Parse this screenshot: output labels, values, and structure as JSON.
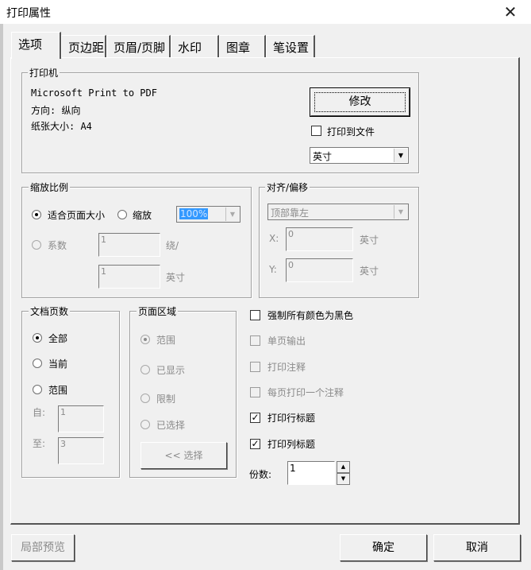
{
  "window": {
    "title": "打印属性",
    "close_symbol": "✕"
  },
  "tabs": [
    "选项",
    "页边距",
    "页眉/页脚",
    "水印",
    "图章",
    "笔设置"
  ],
  "printer_group": {
    "legend": "打印机",
    "printer_name": "Microsoft Print to PDF",
    "orientation": "方向: 纵向",
    "paper_size": "纸张大小: A4",
    "modify_button": "修改",
    "print_to_file": {
      "label": "打印到文件",
      "checked": false
    },
    "unit_select": "英寸"
  },
  "scale_group": {
    "legend": "缩放比例",
    "fit_page": {
      "label": "适合页面大小",
      "selected": true
    },
    "zoom": {
      "label": "缩放",
      "selected": false,
      "value": "100%"
    },
    "factor": {
      "label": "系数",
      "selected": false,
      "value1": "1",
      "unit1": "绕/",
      "value2": "1",
      "unit2": "英寸"
    }
  },
  "align_group": {
    "legend": "对齐/偏移",
    "align_select": "顶部靠左",
    "x": {
      "label": "X:",
      "value": "0",
      "unit": "英寸"
    },
    "y": {
      "label": "Y:",
      "value": "0",
      "unit": "英寸"
    }
  },
  "doc_pages_group": {
    "legend": "文档页数",
    "all": {
      "label": "全部",
      "selected": true
    },
    "current": {
      "label": "当前",
      "selected": false
    },
    "range": {
      "label": "范围",
      "selected": false
    },
    "from": {
      "label": "自:",
      "value": "1"
    },
    "to": {
      "label": "至:",
      "value": "3"
    }
  },
  "page_area_group": {
    "legend": "页面区域",
    "range": {
      "label": "范围",
      "selected": true
    },
    "displayed": {
      "label": "已显示",
      "selected": false
    },
    "limit": {
      "label": "限制",
      "selected": false
    },
    "selected_area": {
      "label": "已选择",
      "selected": false
    },
    "select_button": "<< 选择"
  },
  "options": {
    "force_black": {
      "label": "强制所有颜色为黑色",
      "checked": false,
      "enabled": true
    },
    "single_page": {
      "label": "单页输出",
      "checked": false,
      "enabled": false
    },
    "print_notes": {
      "label": "打印注释",
      "checked": false,
      "enabled": false
    },
    "one_note_per_page": {
      "label": "每页打印一个注释",
      "checked": false,
      "enabled": false
    },
    "print_row_titles": {
      "label": "打印行标题",
      "checked": true,
      "enabled": true
    },
    "print_col_titles": {
      "label": "打印列标题",
      "checked": true,
      "enabled": true
    },
    "copies": {
      "label": "份数:",
      "value": "1"
    }
  },
  "footer": {
    "preview_button": "局部预览",
    "ok_button": "确定",
    "cancel_button": "取消"
  },
  "colors": {
    "background": "#f0f0f0",
    "disabled_text": "#8a8a8a",
    "highlight": "#3399ff"
  }
}
